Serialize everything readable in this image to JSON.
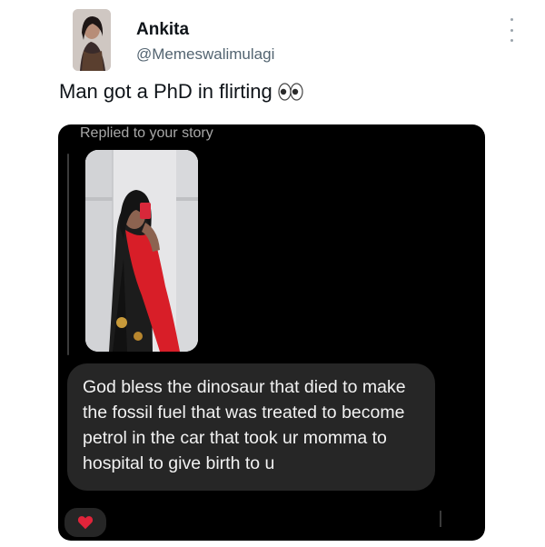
{
  "tweet": {
    "author_name": "Ankita",
    "author_handle": "@Memeswalimulagi",
    "text": "Man got a PhD in flirting",
    "emoji_icon": "eyes-emoji-icon"
  },
  "dm": {
    "replied_label": "Replied to your story",
    "message": "God bless the dinosaur that died to make the fossil fuel that was treated to become petrol in the car that took ur momma to hospital to give birth to u",
    "reaction_icon": "red-heart-icon"
  },
  "colors": {
    "card_background": "#000000",
    "bubble_background": "#262626",
    "handle_gray": "#536471",
    "heart_red": "#e0243a"
  }
}
